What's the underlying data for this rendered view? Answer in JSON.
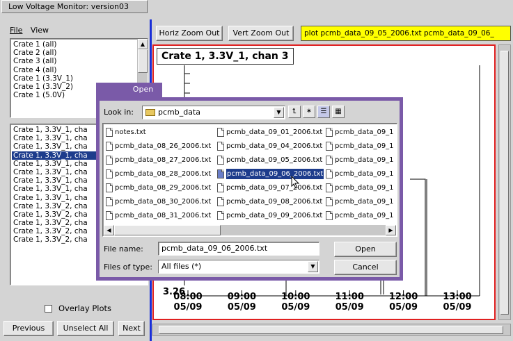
{
  "window": {
    "title": "Low Voltage Monitor: version03"
  },
  "menu": {
    "file": "File",
    "view": "View"
  },
  "crate_list": {
    "items": [
      "Crate 1 (all)",
      "Crate 2 (all)",
      "Crate 3 (all)",
      "Crate 4 (all)",
      "Crate 1 (3.3V_1)",
      "Crate 1 (3.3V_2)",
      "Crate 1 (5.0V)"
    ]
  },
  "channel_list": {
    "items": [
      "Crate 1, 3.3V_1, cha",
      "Crate 1, 3.3V_1, cha",
      "Crate 1, 3.3V_1, cha",
      "Crate 1, 3.3V_1, cha",
      "Crate 1, 3.3V_1, cha",
      "Crate 1, 3.3V_1, cha",
      "Crate 1, 3.3V_1, cha",
      "Crate 1, 3.3V_1, cha",
      "Crate 1, 3.3V_1, cha",
      "Crate 1, 3.3V_2, cha",
      "Crate 1, 3.3V_2, cha",
      "Crate 1, 3.3V_2, cha",
      "Crate 1, 3.3V_2, cha",
      "Crate 1, 3.3V_2, cha"
    ],
    "selected_index": 3
  },
  "overlay": {
    "label": "Overlay Plots",
    "checked": false
  },
  "bottom_buttons": {
    "previous": "Previous",
    "unselect_all": "Unselect All",
    "next": "Next"
  },
  "toolbar": {
    "horiz_zoom_out": "Horiz Zoom Out",
    "vert_zoom_out": "Vert Zoom Out",
    "plot_command": "plot pcmb_data_09_05_2006.txt pcmb_data_09_06_"
  },
  "plot": {
    "title": "Crate 1, 3.3V_1, chan 3",
    "y_tick_visible": "3.26",
    "x_ticks": [
      {
        "time": "08:00",
        "date": "05/09"
      },
      {
        "time": "09:00",
        "date": "05/09"
      },
      {
        "time": "10:00",
        "date": "05/09"
      },
      {
        "time": "11:00",
        "date": "05/09"
      },
      {
        "time": "12:00",
        "date": "05/09"
      },
      {
        "time": "13:00",
        "date": "05/09"
      }
    ],
    "frame_color": "#e02020"
  },
  "dialog": {
    "title": "Open",
    "look_in_label": "Look in:",
    "look_in_value": "pcmb_data",
    "files": [
      [
        "notes.txt",
        "pcmb_data_09_01_2006.txt",
        "pcmb_data_09_1"
      ],
      [
        "pcmb_data_08_26_2006.txt",
        "pcmb_data_09_04_2006.txt",
        "pcmb_data_09_1"
      ],
      [
        "pcmb_data_08_27_2006.txt",
        "pcmb_data_09_05_2006.txt",
        "pcmb_data_09_1"
      ],
      [
        "pcmb_data_08_28_2006.txt",
        "pcmb_data_09_06_2006.txt",
        "pcmb_data_09_1"
      ],
      [
        "pcmb_data_08_29_2006.txt",
        "pcmb_data_09_07_2006.txt",
        "pcmb_data_09_1"
      ],
      [
        "pcmb_data_08_30_2006.txt",
        "pcmb_data_09_08_2006.txt",
        "pcmb_data_09_1"
      ],
      [
        "pcmb_data_08_31_2006.txt",
        "pcmb_data_09_09_2006.txt",
        "pcmb_data_09_1"
      ]
    ],
    "selected_file": "pcmb_data_09_06_2006.txt",
    "file_name_label": "File name:",
    "file_name_value": "pcmb_data_09_06_2006.txt",
    "file_type_label": "Files of type:",
    "file_type_value": "All files (*)",
    "open_button": "Open",
    "cancel_button": "Cancel",
    "accent": "#7a5aa8"
  }
}
